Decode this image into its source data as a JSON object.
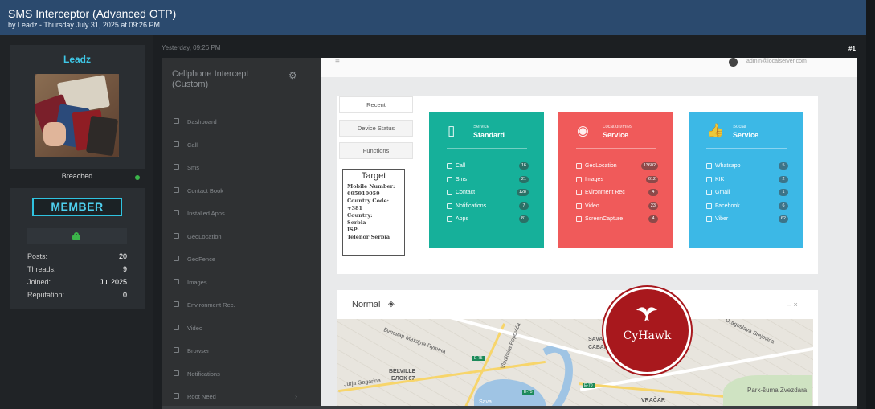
{
  "thread": {
    "title": "SMS Interceptor (Advanced OTP)",
    "byline": "by Leadz - Thursday July 31, 2025 at 09:26 PM"
  },
  "author": {
    "username": "Leadz",
    "status": "Breached",
    "rank": "MEMBER",
    "stats": [
      {
        "label": "Posts:",
        "value": "20"
      },
      {
        "label": "Threads:",
        "value": "9"
      },
      {
        "label": "Joined:",
        "value": "Jul 2025"
      },
      {
        "label": "Reputation:",
        "value": "0"
      }
    ]
  },
  "post": {
    "timestamp": "Yesterday, 09:26 PM",
    "number": "#1"
  },
  "screenshot": {
    "app_title": "Cellphone Intercept (Custom)",
    "nav": [
      {
        "label": "Dashboard",
        "icon": "dashboard-icon"
      },
      {
        "label": "Call",
        "icon": "call-icon"
      },
      {
        "label": "Sms",
        "icon": "sms-icon"
      },
      {
        "label": "Contact Book",
        "icon": "contact-icon"
      },
      {
        "label": "Installed Apps",
        "icon": "apps-icon"
      },
      {
        "label": "GeoLocation",
        "icon": "geolocation-icon"
      },
      {
        "label": "GeoFence",
        "icon": "geofence-icon"
      },
      {
        "label": "Images",
        "icon": "images-icon"
      },
      {
        "label": "Environment Rec.",
        "icon": "environment-icon"
      },
      {
        "label": "Video",
        "icon": "video-icon"
      },
      {
        "label": "Browser",
        "icon": "browser-icon"
      },
      {
        "label": "Notifications",
        "icon": "notifications-icon"
      },
      {
        "label": "Root Need",
        "icon": "root-icon"
      }
    ],
    "user_email": "admin@localserver.com",
    "tabs": [
      "Recent",
      "Device Status",
      "Functions"
    ],
    "target": {
      "heading": "Target",
      "details": "Mobile Number:\n695910059\nCountry Code:\n+381\nCountry:\nSerbia\nISP:\nTelenor Serbia"
    },
    "cards": [
      {
        "caption": "Service",
        "title": "Standard",
        "color": "#16b09a",
        "rows": [
          {
            "label": "Call",
            "count": "16"
          },
          {
            "label": "Sms",
            "count": "21"
          },
          {
            "label": "Contact",
            "count": "128"
          },
          {
            "label": "Notifications",
            "count": "7"
          },
          {
            "label": "Apps",
            "count": "81"
          }
        ]
      },
      {
        "caption": "Location/Files",
        "title": "Service",
        "color": "#f05a5a",
        "rows": [
          {
            "label": "GeoLocation",
            "count": "13602"
          },
          {
            "label": "Images",
            "count": "612"
          },
          {
            "label": "Evironment Rec",
            "count": "4"
          },
          {
            "label": "Video",
            "count": "23"
          },
          {
            "label": "ScreenCapture",
            "count": "4"
          }
        ]
      },
      {
        "caption": "Social",
        "title": "Service",
        "color": "#3cb8e6",
        "rows": [
          {
            "label": "Whatsapp",
            "count": "5"
          },
          {
            "label": "KIK",
            "count": "2"
          },
          {
            "label": "Gmail",
            "count": "1"
          },
          {
            "label": "Facebook",
            "count": "6"
          },
          {
            "label": "Viber",
            "count": "62"
          }
        ]
      }
    ],
    "map_panel": {
      "title": "Normal",
      "controls": "– ×",
      "labels": [
        "Булевар Михајла Пупина",
        "SAVAMALA",
        "САВАМАЛА",
        "BELVILLE",
        "БЛОК 67",
        "Jurja Gagarina",
        "VRAČAR",
        "Park-šuma Zvezdara",
        "Dragoslava Srejovića",
        "Vladimira Popovića",
        "E-75",
        "E-75",
        "E-70",
        "Sava"
      ]
    }
  },
  "watermark": {
    "text": "CyHawk"
  }
}
